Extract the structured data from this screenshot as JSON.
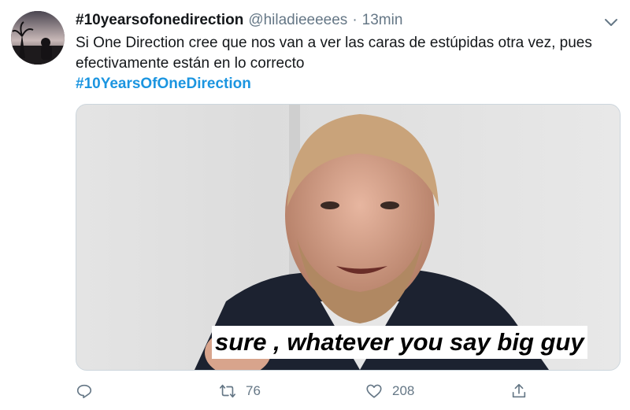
{
  "tweet": {
    "display_name": "#10yearsofonedirection",
    "handle": "@hiladieeeees",
    "separator": "·",
    "timestamp": "13min",
    "text": "Si One Direction cree que nos van a ver las caras de estúpidas otra vez, pues efectivamente están en lo correcto",
    "hashtag": "#10YearsOfOneDirection",
    "media": {
      "caption": "sure , whatever you say big guy"
    }
  },
  "actions": {
    "reply": {
      "icon": "reply-icon"
    },
    "retweet": {
      "icon": "retweet-icon",
      "count": "76"
    },
    "like": {
      "icon": "heart-icon",
      "count": "208"
    },
    "share": {
      "icon": "share-icon"
    }
  },
  "colors": {
    "link": "#1b95e0",
    "muted": "#657786",
    "text": "#14171a",
    "border": "#ccd6dd"
  }
}
